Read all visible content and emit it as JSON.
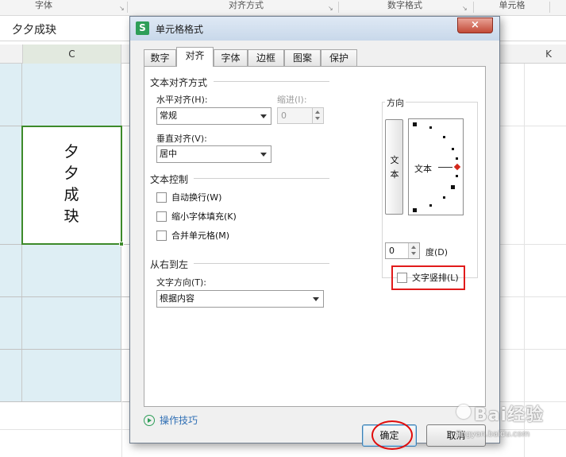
{
  "ribbon": {
    "groups": [
      "字体",
      "对齐方式",
      "数字格式",
      "单元格"
    ]
  },
  "formula_bar": {
    "value": "夕夕成玦"
  },
  "columns": {
    "c": "C",
    "k": "K"
  },
  "cell": {
    "chars": [
      "夕",
      "夕",
      "成",
      "玦"
    ]
  },
  "dialog": {
    "title": "单元格格式",
    "app_icon": "S",
    "close": "×",
    "tabs": [
      "数字",
      "对齐",
      "字体",
      "边框",
      "图案",
      "保护"
    ],
    "active_tab": "对齐",
    "text_alignment": {
      "section": "文本对齐方式",
      "horizontal_label": "水平对齐(H):",
      "horizontal_value": "常规",
      "indent_label": "缩进(I):",
      "indent_value": "0",
      "vertical_label": "垂直对齐(V):",
      "vertical_value": "居中"
    },
    "text_control": {
      "section": "文本控制",
      "wrap": "自动换行(W)",
      "shrink": "缩小字体填充(K)",
      "merge": "合并单元格(M)"
    },
    "rtl": {
      "section": "从右到左",
      "direction_label": "文字方向(T):",
      "direction_value": "根据内容"
    },
    "orientation": {
      "section": "方向",
      "vertical_text_chars": [
        "文",
        "本"
      ],
      "dial_text": "文本",
      "degrees_value": "0",
      "degrees_label": "度(D)",
      "vertical_checkbox": "文字竖排(L)"
    },
    "tips": "操作技巧",
    "ok": "确定",
    "cancel": "取消"
  },
  "watermark": {
    "big": "Bai经验",
    "small": "jingyan.baidu.com"
  }
}
